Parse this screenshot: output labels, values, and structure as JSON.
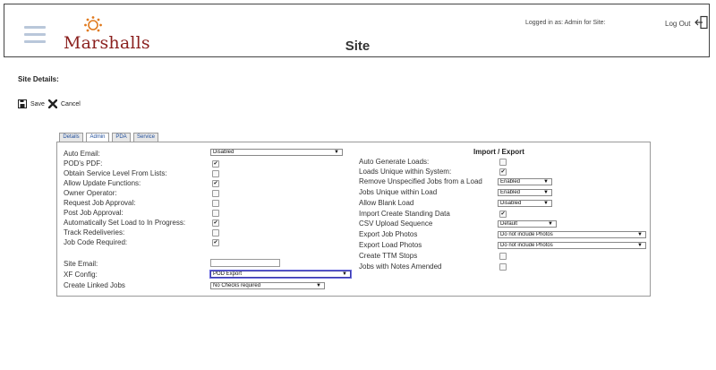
{
  "header": {
    "brand": "Marshalls",
    "page_title": "Site",
    "logged_in": "Logged in as: Admin for Site:",
    "logout_label": "Log Out"
  },
  "page": {
    "section_title": "Site Details:"
  },
  "toolbar": {
    "save_label": "Save",
    "cancel_label": "Cancel"
  },
  "tabs": [
    {
      "label": "Details",
      "active": false
    },
    {
      "label": "Admin",
      "active": true
    },
    {
      "label": "PDA",
      "active": false
    },
    {
      "label": "Service",
      "active": false
    }
  ],
  "left": {
    "auto_email": {
      "label": "Auto Email:",
      "value": "Disabled"
    },
    "pods_pdf": {
      "label": "POD's PDF:",
      "checked": true
    },
    "obtain_service": {
      "label": "Obtain Service Level From Lists:",
      "checked": false
    },
    "allow_update": {
      "label": "Allow Update Functions:",
      "checked": true
    },
    "owner_operator": {
      "label": "Owner Operator:",
      "checked": false
    },
    "request_job": {
      "label": "Request Job Approval:",
      "checked": false
    },
    "post_job": {
      "label": "Post Job Approval:",
      "checked": false
    },
    "auto_set_load": {
      "label": "Automatically Set Load to In Progress:",
      "checked": true
    },
    "track_redeliveries": {
      "label": "Track Redeliveries:",
      "checked": false
    },
    "job_code_required": {
      "label": "Job Code Required:",
      "checked": true
    },
    "site_email": {
      "label": "Site Email:",
      "value": ""
    },
    "xf_config": {
      "label": "XF Config:",
      "value": "POD Export"
    },
    "create_linked_jobs": {
      "label": "Create Linked Jobs",
      "value": "No Checks required"
    }
  },
  "right": {
    "section_title": "Import / Export",
    "auto_generate_loads": {
      "label": "Auto Generate Loads:",
      "checked": false
    },
    "loads_unique": {
      "label": "Loads Unique within System:",
      "checked": true
    },
    "remove_unspecified": {
      "label": "Remove Unspecified Jobs from a Load",
      "value": "Enabled"
    },
    "jobs_unique": {
      "label": "Jobs Unique within Load",
      "value": "Enabled"
    },
    "allow_blank_load": {
      "label": "Allow Blank Load",
      "value": "Disabled"
    },
    "import_standing": {
      "label": "Import Create Standing Data",
      "checked": true
    },
    "csv_upload": {
      "label": "CSV Upload Sequence",
      "value": "Default"
    },
    "export_job_photos": {
      "label": "Export Job Photos",
      "value": "Do not include Photos"
    },
    "export_load_photos": {
      "label": "Export Load Photos",
      "value": "Do not include Photos"
    },
    "create_ttm_stops": {
      "label": "Create TTM Stops",
      "checked": false
    },
    "jobs_notes_amended": {
      "label": "Jobs with Notes Amended",
      "checked": false
    }
  },
  "icons": {
    "menu": "hamburger-menu-icon",
    "logo": "marshalls-sun-logo-icon",
    "logout": "logout-door-icon",
    "save": "save-icon",
    "cancel": "cancel-x-icon",
    "check": "✔",
    "dropdown": "▼"
  },
  "colors": {
    "brand": "#8a1f1d",
    "logo_accent": "#e07a1e",
    "tab_text": "#1f4d9a",
    "focus": "#3a3aa7"
  }
}
